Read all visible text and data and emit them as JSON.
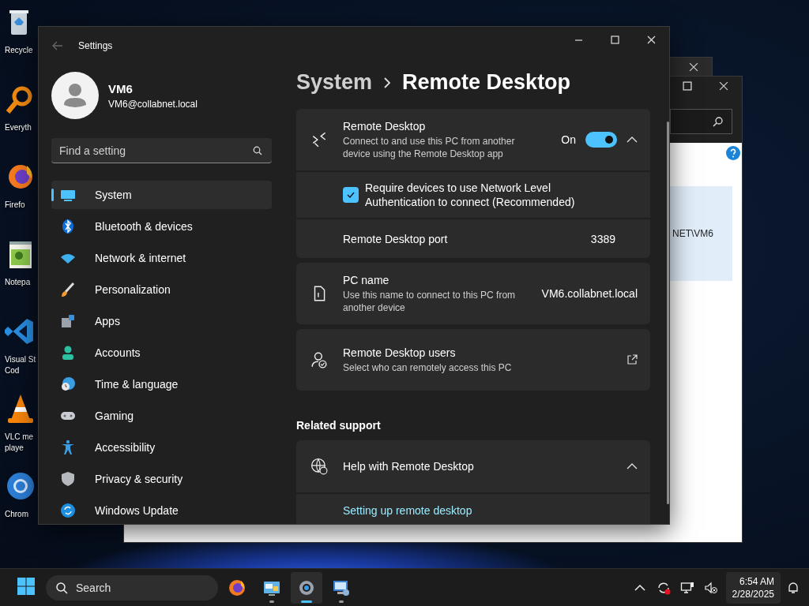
{
  "desktop_icons": [
    {
      "label_lines": [
        "Recycle"
      ]
    },
    {
      "label_lines": [
        "Everyth"
      ]
    },
    {
      "label_lines": [
        "Firefo"
      ]
    },
    {
      "label_lines": [
        "Notepa"
      ]
    },
    {
      "label_lines": [
        "Visual St",
        "Cod"
      ]
    },
    {
      "label_lines": [
        "VLC me",
        "playe"
      ]
    },
    {
      "label_lines": [
        "Chrom"
      ]
    }
  ],
  "back_window": {
    "content_text": "NET\\VM6"
  },
  "settings": {
    "title": "Settings",
    "user": {
      "name": "VM6",
      "email": "VM6@collabnet.local"
    },
    "search": {
      "placeholder": "Find a setting"
    },
    "nav": [
      {
        "label": "System",
        "selected": true
      },
      {
        "label": "Bluetooth & devices",
        "selected": false
      },
      {
        "label": "Network & internet",
        "selected": false
      },
      {
        "label": "Personalization",
        "selected": false
      },
      {
        "label": "Apps",
        "selected": false
      },
      {
        "label": "Accounts",
        "selected": false
      },
      {
        "label": "Time & language",
        "selected": false
      },
      {
        "label": "Gaming",
        "selected": false
      },
      {
        "label": "Accessibility",
        "selected": false
      },
      {
        "label": "Privacy & security",
        "selected": false
      },
      {
        "label": "Windows Update",
        "selected": false
      }
    ],
    "breadcrumb": {
      "parent": "System",
      "current": "Remote Desktop"
    },
    "cards": [
      {
        "kind": "toggle",
        "title": "Remote Desktop",
        "description": "Connect to and use this PC from another device using the Remote Desktop app",
        "toggle_label": "On",
        "on": true,
        "expanded": true,
        "rows": [
          {
            "kind": "checkbox",
            "label": "Require devices to use Network Level Authentication to connect (Recommended)",
            "checked": true
          },
          {
            "kind": "value",
            "label": "Remote Desktop port",
            "value": "3389"
          }
        ]
      },
      {
        "kind": "value",
        "title": "PC name",
        "description": "Use this name to connect to this PC from another device",
        "value": "VM6.collabnet.local"
      },
      {
        "kind": "link",
        "title": "Remote Desktop users",
        "description": "Select who can remotely access this PC"
      }
    ],
    "related_support": {
      "heading": "Related support",
      "cards": [
        {
          "title": "Help with Remote Desktop",
          "expanded": true,
          "links": [
            "Setting up remote desktop"
          ]
        }
      ]
    }
  },
  "taskbar": {
    "search_placeholder": "Search",
    "apps": [
      {
        "running": false,
        "selected": false
      },
      {
        "running": true,
        "selected": false
      },
      {
        "running": true,
        "selected": true
      },
      {
        "running": true,
        "selected": false
      }
    ],
    "time": "6:54 AM",
    "date": "2/28/2025"
  }
}
